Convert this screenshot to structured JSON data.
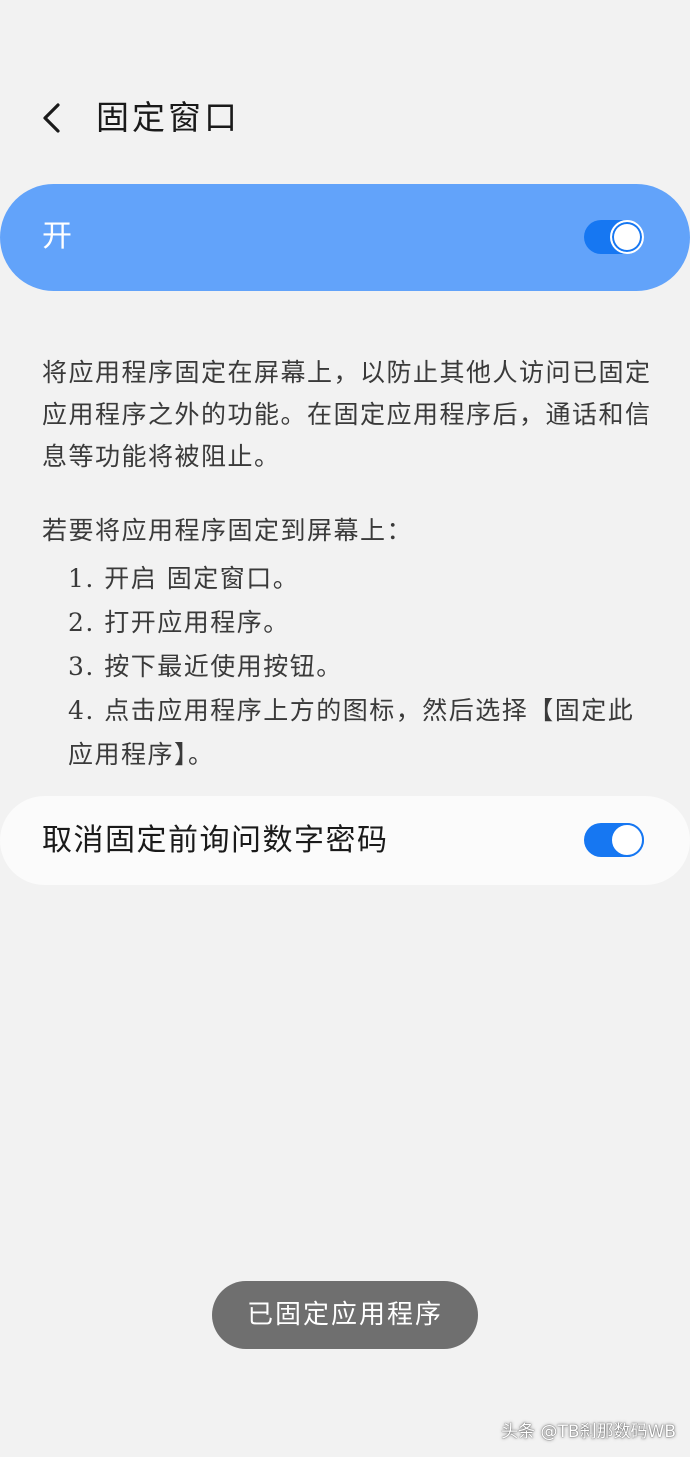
{
  "header": {
    "title": "固定窗口",
    "back_icon": "chevron-left-icon"
  },
  "master_switch": {
    "label": "开",
    "state": "on",
    "card_color": "#62a3fa",
    "toggle_color": "#1677f2"
  },
  "description": {
    "text": "将应用程序固定在屏幕上，以防止其他人访问已固定应用程序之外的功能。在固定应用程序后，通话和信息等功能将被阻止。",
    "steps_title": "若要将应用程序固定到屏幕上：",
    "steps": [
      "1. 开启 固定窗口。",
      "2. 打开应用程序。",
      "3. 按下最近使用按钮。",
      "4. 点击应用程序上方的图标，然后选择【固定此应用程序】。"
    ]
  },
  "pin_setting": {
    "label": "取消固定前询问数字密码",
    "state": "on"
  },
  "toast": {
    "text": "已固定应用程序"
  },
  "watermark": {
    "text": "头条 @TB刹那数码WB"
  }
}
